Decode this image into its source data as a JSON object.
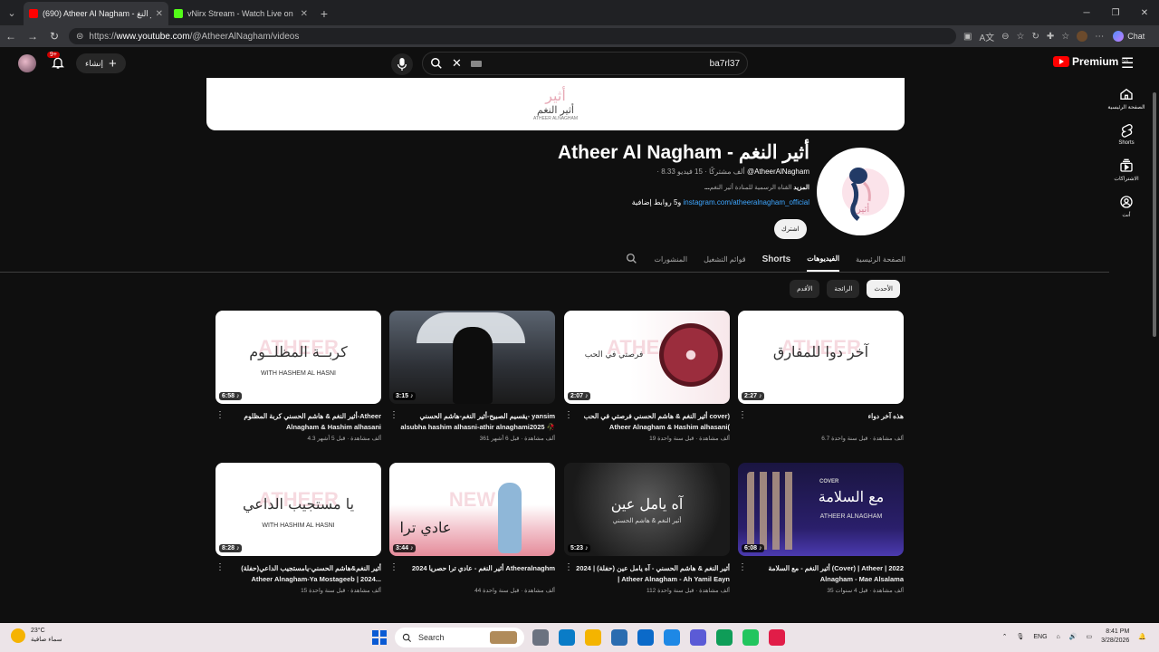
{
  "browser": {
    "tabs": [
      {
        "title": "(690) Atheer Al Nagham - أثير النغ",
        "active": true,
        "favicon_color": "#ff0000"
      },
      {
        "title": "vNirx Stream - Watch Live on Kick",
        "active": false,
        "favicon_color": "#53fc18"
      }
    ],
    "url_host": "www.youtube.com",
    "url_path": "/@AtheerAlNagham/videos",
    "url_scheme": "https://",
    "chat_label": "Chat"
  },
  "yt_header": {
    "notif_count": "9+",
    "create_label": "إنشاء",
    "search_query": "ba7rl37",
    "premium_label": "Premium",
    "premium_region": "SA"
  },
  "rail": [
    {
      "label": "الصفحة الرئيسية",
      "icon": "home-icon"
    },
    {
      "label": "Shorts",
      "icon": "shorts-icon"
    },
    {
      "label": "الاشتراكات",
      "icon": "subscriptions-icon"
    },
    {
      "label": "أنت",
      "icon": "you-icon"
    }
  ],
  "banner": {
    "art": "أثير",
    "ar": "أثير النغم",
    "en": "ATHEER ALNAGHAM"
  },
  "channel": {
    "name": "Atheer Al Nagham - أثير النغم",
    "handle": "@AtheerAlNagham",
    "meta": "· 8.33 ألف مشتركًا · 15 فيديو",
    "desc_main": "القناه الرسمية للمنادة أثير النغم",
    "desc_more": "...المزيد",
    "link": "instagram.com/atheeralnagham_official",
    "links_more": "و5 روابط إضافية",
    "subscribe_label": "اشترك"
  },
  "chan_tabs": [
    "الصفحة الرئيسية",
    "الفيديوهات",
    "Shorts",
    "قوائم التشغيل",
    "المنشورات"
  ],
  "active_tab": "الفيديوهات",
  "chips": [
    {
      "label": "الأحدث",
      "active": true
    },
    {
      "label": "الرائجة",
      "active": false
    },
    {
      "label": "الأقدم",
      "active": false
    }
  ],
  "videos": [
    {
      "title": "هذه آخر دواء",
      "meta": "6.7 ألف مشاهدة · قبل سنة واحدة",
      "duration": "2:27",
      "thumb_text": "آخر دوا للمفارق",
      "thumb_sub": "",
      "watermark": "ATHEER",
      "thumb_style": "white"
    },
    {
      "title": "أثير النغم & هاشم الحسني فرصتي في الحب cover) Atheer Alnagham & Hashim alhasani(",
      "meta": "19 ألف مشاهدة · قبل سنة واحدة",
      "duration": "2:07",
      "thumb_text": "فرصتي في الحب",
      "thumb_sub": "",
      "watermark": "ATHEER",
      "thumb_style": "vinyl"
    },
    {
      "title": "يقسيم الصبيح-أثير النغم-هاشم الحسني- yansim alsubha hashim alhasni-athir alnaghami2025 🥀",
      "meta": "361 ألف مشاهدة · قبل 6 أشهر",
      "duration": "3:15",
      "thumb_text": "",
      "thumb_sub": "",
      "watermark": "",
      "thumb_style": "photo"
    },
    {
      "title": "أثير النغم & هاشم الحسني كربة المظلوم-Atheer Alnagham & Hashim alhasani",
      "meta": "4.3 ألف مشاهدة · قبل 5 أشهر",
      "duration": "6:58",
      "thumb_text": "كربــة المظلــوم",
      "thumb_sub": "WITH HASHEM AL HASNI",
      "watermark": "ATHEER",
      "thumb_style": "white"
    },
    {
      "title": "أثير النغم - مع السلامة (Cover) | Atheer | 2022 Alnagham - Mae Alsalama",
      "meta": "35 ألف مشاهدة · قبل 4 سنوات",
      "duration": "6:08",
      "thumb_text": "مع السلامة",
      "thumb_sub": "ATHEER ALNAGHAM",
      "watermark": "COVER",
      "thumb_style": "purple"
    },
    {
      "title": "أثير النغم & هاشم الحسني - آه يامل عين (حفلة) | 2024 | Atheer Alnagham - Ah Yamil Eayn",
      "meta": "112 ألف مشاهدة · قبل سنة واحدة",
      "duration": "5:23",
      "thumb_text": "آه يامل عين",
      "thumb_sub": "أثير النغم & هاشم الحسني",
      "watermark": "",
      "thumb_style": "dark"
    },
    {
      "title": "أثير النغم - عادي ترا حصريا 2024 Atheeralnaghm",
      "meta": "44 ألف مشاهدة · قبل سنة واحدة",
      "duration": "3:44",
      "thumb_text": "عادي ترا",
      "thumb_sub": "",
      "watermark": "NEW",
      "thumb_style": "beach"
    },
    {
      "title": "أثير النغم&هاشم الحسني-يامستجيب الداعي(حفلة) Atheer Alnagham-Ya Mostageeb | 2024...",
      "meta": "15 ألف مشاهدة · قبل سنة واحدة",
      "duration": "8:28",
      "thumb_text": "يا مستجيب الداعي",
      "thumb_sub": "WITH HASHIM AL HASNI",
      "watermark": "ATHEER",
      "thumb_style": "white"
    }
  ],
  "taskbar": {
    "temp": "23°C",
    "weather": "سماء صافية",
    "search_label": "Search",
    "lang": "ENG",
    "time": "8:41 PM",
    "date": "3/28/2026",
    "icons": [
      "#6b7280",
      "#0a7cc7",
      "#f4b400",
      "#2b6cb0",
      "#0b6ac9",
      "#1e88e5",
      "#5b5bd6",
      "#0f9d58",
      "#22c55e",
      "#e11d48"
    ]
  },
  "colors": {
    "accent_link": "#3ea6ff",
    "yt_red": "#ff0000",
    "bg": "#0f0f0f"
  }
}
